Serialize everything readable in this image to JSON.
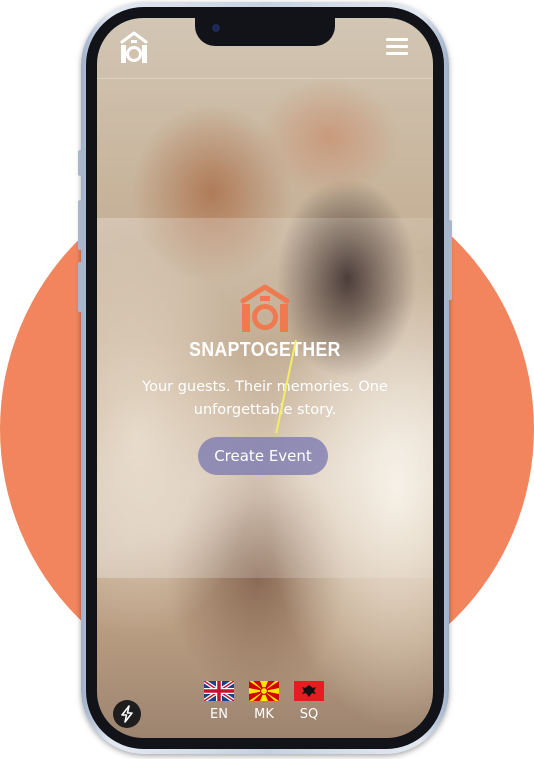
{
  "app": {
    "brand_name": "SNAPTOGETHER",
    "tagline": "Your guests. Their memories. One unforgettable story.",
    "cta_label": "Create Event"
  },
  "languages": [
    {
      "code": "EN",
      "flag": "uk-flag-icon"
    },
    {
      "code": "MK",
      "flag": "north-macedonia-flag-icon"
    },
    {
      "code": "SQ",
      "flag": "albania-flag-icon"
    }
  ],
  "icons": {
    "logo": "house-camera-logo",
    "menu": "hamburger-menu-icon",
    "bolt": "lightning-bolt-icon"
  },
  "colors": {
    "accent": "#f2855e",
    "brand_orange": "#f07a4f",
    "button_bg": "#807eb2"
  }
}
